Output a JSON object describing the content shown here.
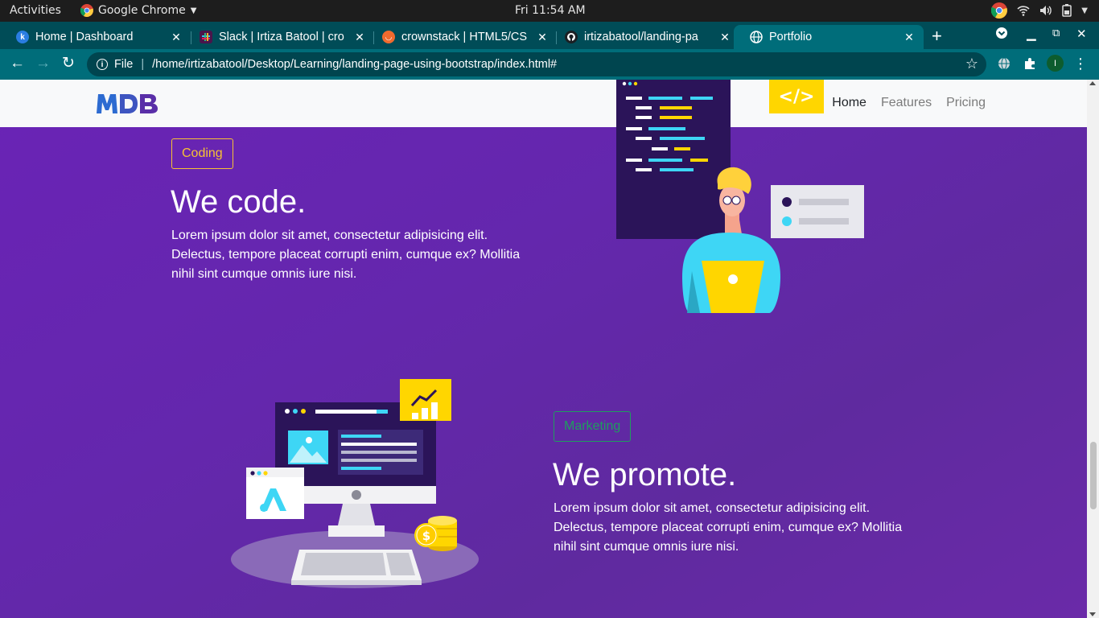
{
  "system": {
    "activities": "Activities",
    "app_name": "Google Chrome",
    "clock": "Fri 11:54 AM"
  },
  "tabs": [
    {
      "title": "Home | Dashboard",
      "favicon": "k"
    },
    {
      "title": "Slack | Irtiza Batool | cro",
      "favicon": "slack"
    },
    {
      "title": "crownstack | HTML5/CS",
      "favicon": "crownstack"
    },
    {
      "title": "irtizabatool/landing-pa",
      "favicon": "github"
    },
    {
      "title": "Portfolio",
      "favicon": "globe",
      "active": true
    }
  ],
  "toolbar": {
    "scheme": "File",
    "url": "/home/irtizabatool/Desktop/Learning/landing-page-using-bootstrap/index.html#",
    "profile_initial": "I"
  },
  "site": {
    "logo": "MDB",
    "nav": [
      {
        "label": "Home",
        "active": true
      },
      {
        "label": "Features",
        "active": false
      },
      {
        "label": "Pricing",
        "active": false
      }
    ],
    "sections": [
      {
        "badge": "Coding",
        "badge_color": "#f7c233",
        "heading": "We code.",
        "text_lines": [
          "Lorem ipsum dolor sit amet, consectetur adipisicing elit.",
          "Delectus, tempore placeat corrupti enim, cumque ex? Mollitia",
          "nihil sint cumque omnis iure nisi."
        ]
      },
      {
        "badge": "Marketing",
        "badge_color": "#1f9d5f",
        "heading": "We promote.",
        "text_lines": [
          "Lorem ipsum dolor sit amet, consectetur adipisicing elit.",
          "Delectus, tempore placeat corrupti enim, cumque ex? Mollitia",
          "nihil sint cumque omnis iure nisi."
        ]
      }
    ]
  },
  "colors": {
    "tab_bar": "#004c57",
    "toolbar": "#006d7a",
    "page_purple": "#6427ad",
    "illustration_yellow": "#ffd600",
    "illustration_cyan": "#3ed6f5"
  }
}
